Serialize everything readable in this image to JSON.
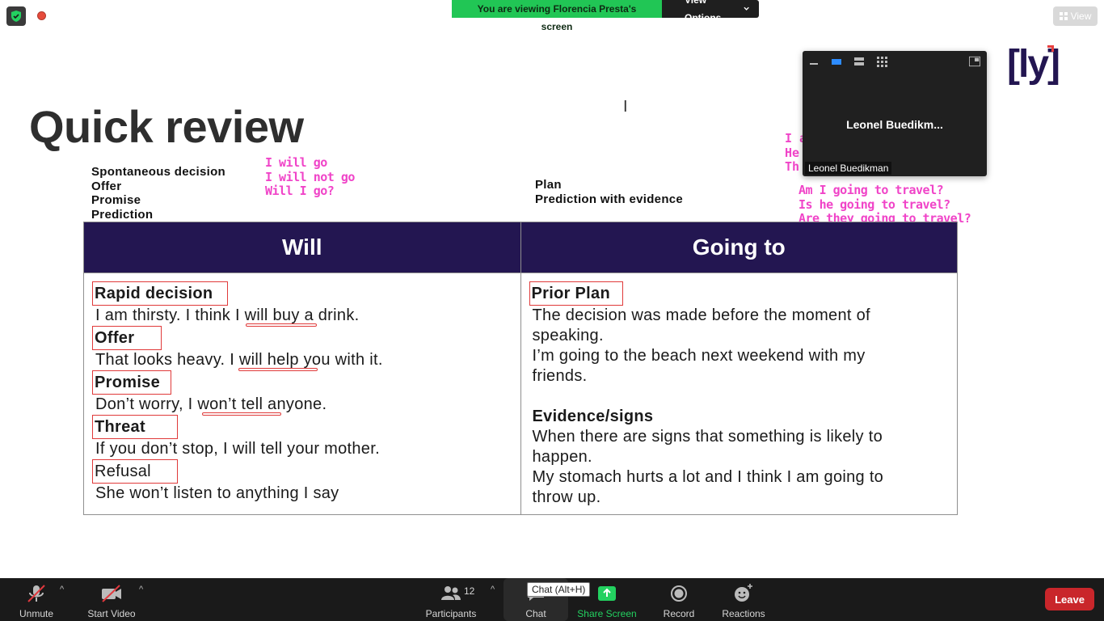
{
  "top_bar": {
    "viewing_banner": "You are viewing Florencia Presta's screen",
    "view_options": "View Options",
    "view_button": "View"
  },
  "slide": {
    "title": "Quick review",
    "logo": "[ly]",
    "will_uses": [
      "Spontaneous decision",
      "Offer",
      "Promise",
      "Prediction"
    ],
    "will_annotations": [
      "I will go",
      "I will not go",
      "Will I go?"
    ],
    "going_uses": [
      "Plan",
      "Prediction with evidence"
    ],
    "going_annotations": [
      "Am I going to travel?",
      "Is he going to travel?",
      "Are they going to travel?"
    ],
    "going_annotations_partial": [
      "I a",
      "He",
      "Th"
    ],
    "table": {
      "headers": [
        "Will",
        "Going to"
      ],
      "will_rows": [
        {
          "heading": "Rapid decision",
          "example": "I am thirsty. I think I will buy a drink."
        },
        {
          "heading": "Offer",
          "example": "That looks heavy. I will help you with it."
        },
        {
          "heading": "Promise",
          "example": "Don’t worry, I won’t tell anyone."
        },
        {
          "heading": "Threat",
          "example": "If you don’t stop, I will tell your mother."
        },
        {
          "heading": "Refusal",
          "example": "She won’t listen to anything I say"
        }
      ],
      "going_sections": [
        {
          "heading": "Prior Plan",
          "lines": [
            "The decision was made before the moment of speaking.",
            "I’m going to the beach next weekend with my friends."
          ]
        },
        {
          "heading": "Evidence/signs",
          "lines": [
            "When there are signs that something is likely to happen.",
            "My stomach hurts a lot and I think I am going to throw up."
          ]
        }
      ]
    }
  },
  "video_panel": {
    "center_name": "Leonel  Buedikm...",
    "name_tag": "Leonel Buedikman"
  },
  "toolbar": {
    "unmute": "Unmute",
    "start_video": "Start Video",
    "participants": "Participants",
    "participants_count": "12",
    "chat": "Chat",
    "chat_tooltip": "Chat (Alt+H)",
    "share_screen": "Share Screen",
    "record": "Record",
    "reactions": "Reactions",
    "leave": "Leave"
  },
  "colors": {
    "header_bg": "#231651",
    "annotation": "#f044c8",
    "highlight_box": "#e03a3a",
    "banner_green": "#21c655",
    "leave_red": "#c9262b"
  }
}
